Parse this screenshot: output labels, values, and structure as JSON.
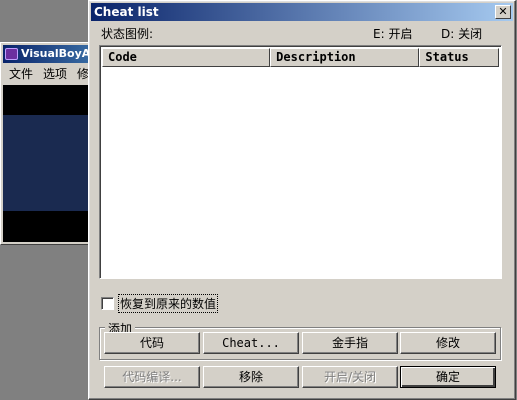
{
  "bg_window": {
    "title": "VisualBoyAdv",
    "menu": [
      "文件",
      "选项",
      "修"
    ]
  },
  "dialog": {
    "title": "Cheat list",
    "close_glyph": "✕",
    "legend_label": "状态图例:",
    "legend_enabled": "E: 开启",
    "legend_disabled": "D: 关闭",
    "columns": [
      "Code",
      "Description",
      "Status"
    ],
    "rows": [],
    "restore_checkbox_label": "恢复到原来的数值",
    "restore_checked": false,
    "add_group_label": "添加",
    "buttons": {
      "code": "代码",
      "cheat": "Cheat...",
      "gold_finger": "金手指",
      "edit": "修改",
      "compile": "代码编译...",
      "remove": "移除",
      "toggle": "开启/关闭",
      "ok": "确定"
    }
  },
  "colors": {
    "titlebar_start": "#0a246a",
    "titlebar_end": "#a6caf0",
    "dialog_face": "#d4d0c8",
    "desktop": "#808080"
  }
}
